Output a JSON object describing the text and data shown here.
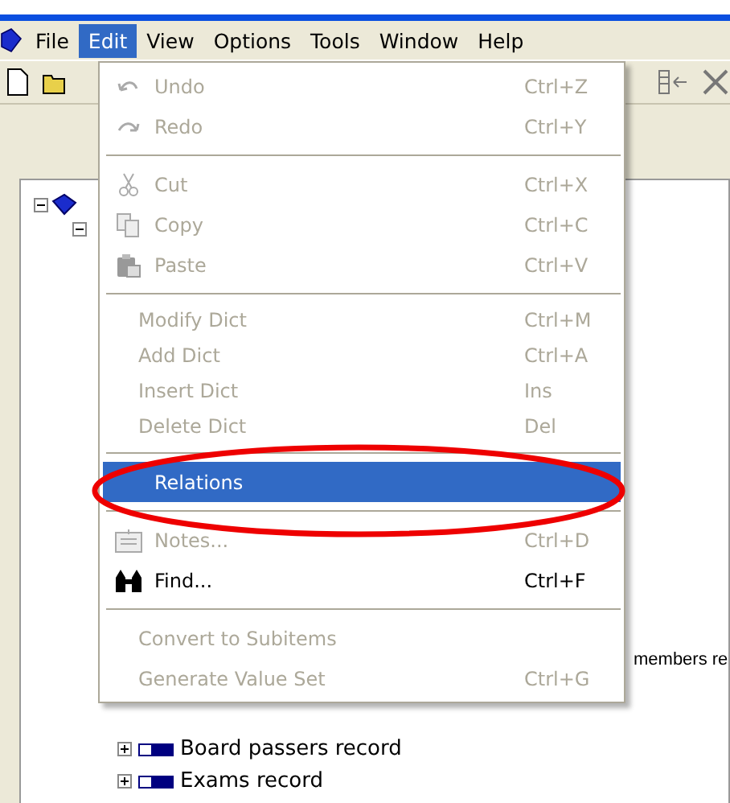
{
  "menu_bar": [
    {
      "label": "File",
      "selected": false
    },
    {
      "label": "Edit",
      "selected": true
    },
    {
      "label": "View",
      "selected": false
    },
    {
      "label": "Options",
      "selected": false
    },
    {
      "label": "Tools",
      "selected": false
    },
    {
      "label": "Window",
      "selected": false
    },
    {
      "label": "Help",
      "selected": false
    }
  ],
  "edit_menu": [
    [
      {
        "label": "Undo",
        "shortcut": "Ctrl+Z",
        "disabled": true,
        "selected": false
      },
      {
        "label": "Redo",
        "shortcut": "Ctrl+Y",
        "disabled": true,
        "selected": false
      }
    ],
    [
      {
        "label": "Cut",
        "shortcut": "Ctrl+X",
        "disabled": true,
        "selected": false
      },
      {
        "label": "Copy",
        "shortcut": "Ctrl+C",
        "disabled": true,
        "selected": false
      },
      {
        "label": "Paste",
        "shortcut": "Ctrl+V",
        "disabled": true,
        "selected": false
      }
    ],
    [
      {
        "label": "Modify Dict",
        "shortcut": "Ctrl+M",
        "disabled": true,
        "selected": false
      },
      {
        "label": "Add Dict",
        "shortcut": "Ctrl+A",
        "disabled": true,
        "selected": false
      },
      {
        "label": "Insert Dict",
        "shortcut": "Ins",
        "disabled": true,
        "selected": false
      },
      {
        "label": "Delete Dict",
        "shortcut": "Del",
        "disabled": true,
        "selected": false
      }
    ],
    [
      {
        "label": "Relations",
        "disabled": false,
        "selected": true
      }
    ],
    [
      {
        "label": "Notes...",
        "shortcut": "Ctrl+D",
        "disabled": true,
        "selected": false
      },
      {
        "label": "Find...",
        "shortcut": "Ctrl+F",
        "disabled": false,
        "selected": false
      }
    ],
    [
      {
        "label": "Convert to Subitems",
        "disabled": true,
        "selected": false
      },
      {
        "label": "Generate Value Set",
        "shortcut": "Ctrl+G",
        "disabled": true,
        "selected": false
      }
    ]
  ],
  "tree": {
    "partial_text": "members re",
    "items": [
      {
        "label": "Board passers record",
        "expanded": false
      },
      {
        "label": "Exams record",
        "expanded": false
      }
    ]
  }
}
